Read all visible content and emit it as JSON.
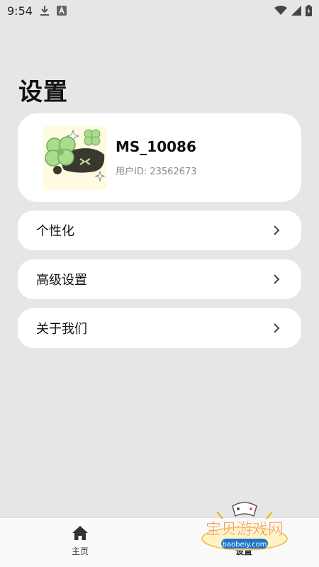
{
  "status_bar": {
    "time": "9:54",
    "icons": [
      "download-icon",
      "a-badge-icon",
      "wifi-icon",
      "signal-icon",
      "battery-icon"
    ]
  },
  "page": {
    "title": "设置"
  },
  "profile": {
    "username": "MS_10086",
    "user_id": "用户ID: 23562673",
    "avatar": "clover-cat-avatar"
  },
  "menu": {
    "items": [
      {
        "label": "个性化"
      },
      {
        "label": "高级设置"
      },
      {
        "label": "关于我们"
      }
    ]
  },
  "bottom_nav": {
    "items": [
      {
        "label": "主页",
        "icon": "home-icon"
      },
      {
        "label": "设置",
        "icon": "settings-icon",
        "active": true
      }
    ]
  },
  "watermark": {
    "title": "宝贝游戏网",
    "url": "baobeiy.com"
  },
  "colors": {
    "background": "#e6e6e6",
    "card": "#ffffff",
    "avatar_background": "#fffbe0",
    "secondary_text": "#8a8a8a",
    "watermark_text": "#f08a24"
  }
}
